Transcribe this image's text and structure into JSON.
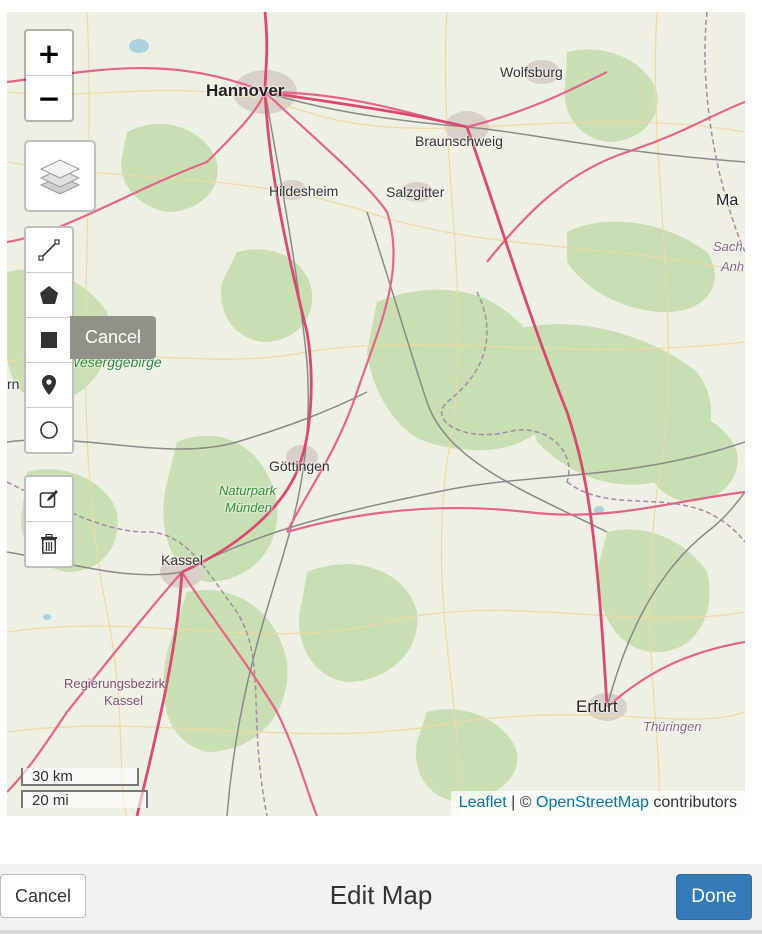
{
  "map": {
    "cities": [
      {
        "key": "hannover",
        "label": "Hannover"
      },
      {
        "key": "wolfsburg",
        "label": "Wolfsburg"
      },
      {
        "key": "braunschweig",
        "label": "Braunschweig"
      },
      {
        "key": "hildesheim",
        "label": "Hildesheim"
      },
      {
        "key": "salzgitter",
        "label": "Salzgitter"
      },
      {
        "key": "goettingen",
        "label": "Göttingen"
      },
      {
        "key": "kassel",
        "label": "Kassel"
      },
      {
        "key": "erfurt",
        "label": "Erfurt"
      }
    ],
    "labels": {
      "naturpark": "Naturpark",
      "muenden": "Münden",
      "regbez1": "Regierungsbezirk",
      "regbez2": "Kassel",
      "thueringen": "Thüringen",
      "weserbergland": "Weserggebirge",
      "ma": "Ma",
      "sach": "Sach",
      "anh": "Anh",
      "rn": "rn"
    },
    "icons": {
      "zoom_in": "plus-icon",
      "zoom_out": "minus-icon",
      "layers": "layers-icon",
      "polyline": "polyline-icon",
      "polygon": "polygon-icon",
      "rectangle": "rectangle-icon",
      "marker": "marker-icon",
      "circle": "circle-icon",
      "edit": "edit-icon",
      "delete": "trash-icon"
    },
    "zoom_in_label": "+",
    "zoom_out_label": "−",
    "cancel_tooltip": "Cancel",
    "scale_km": "30 km",
    "scale_mi": "20 mi",
    "attribution": {
      "leaflet": "Leaflet",
      "separator": " | © ",
      "osm": "OpenStreetMap",
      "suffix": " contributors"
    }
  },
  "footer": {
    "cancel_label": "Cancel",
    "title": "Edit Map",
    "done_label": "Done"
  },
  "colors": {
    "primary": "#337ab7",
    "link": "#0078a8",
    "tooltip_bg": "#919187"
  }
}
